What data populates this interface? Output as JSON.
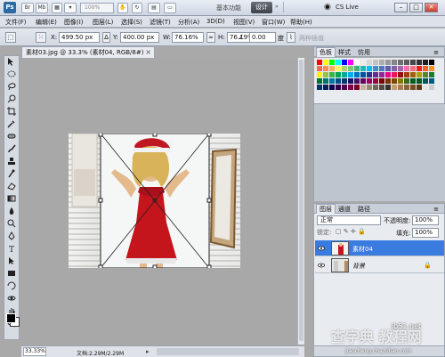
{
  "app": {
    "logo": "Ps",
    "zoom_display": "100%",
    "workspace_label": "基本功能",
    "workspace_active": "设计",
    "workspace_more": "»",
    "cs_live": "CS Live"
  },
  "menu": [
    "文件(F)",
    "编辑(E)",
    "图像(I)",
    "图层(L)",
    "选择(S)",
    "滤镜(T)",
    "分析(A)",
    "3D(D)",
    "视图(V)",
    "窗口(W)",
    "帮助(H)"
  ],
  "options": {
    "x_label": "X:",
    "x_value": "499.50 px",
    "y_label": "Y:",
    "y_value": "400.00 px",
    "w_label": "W:",
    "w_value": "76.16%",
    "h_label": "H:",
    "h_value": "76.19%",
    "angle_value": "0.00",
    "h_skew_label": "度",
    "interp_label": "两种插值"
  },
  "document": {
    "tab_title": "素材03.jpg @ 33.3% (素材04, RGB/8#)",
    "zoom": "33.33%",
    "doc_info": "文档:2.29M/2.29M"
  },
  "swatches_panel": {
    "tabs": [
      "色板",
      "样式",
      "仿用"
    ],
    "colors": [
      "#ff0000",
      "#ffff00",
      "#00ff00",
      "#00ffff",
      "#0000ff",
      "#ff00ff",
      "#ffffff",
      "#ebebeb",
      "#d6d6d6",
      "#c2c2c2",
      "#adadad",
      "#999999",
      "#858585",
      "#707070",
      "#5c5c5c",
      "#474747",
      "#333333",
      "#1f1f1f",
      "#000000",
      "#f26c4f",
      "#f68e55",
      "#fbaf5c",
      "#fff467",
      "#acd372",
      "#7cc576",
      "#3bb878",
      "#1abbb4",
      "#00bff3",
      "#438ccb",
      "#5574b9",
      "#605ca8",
      "#855fa8",
      "#a763a8",
      "#f06ea9",
      "#f26d7d",
      "#ed1c24",
      "#f26522",
      "#f7941d",
      "#fff200",
      "#8dc63f",
      "#39b54a",
      "#00a651",
      "#00a99d",
      "#00aeef",
      "#0072bc",
      "#0054a6",
      "#2e3192",
      "#662d91",
      "#92278f",
      "#ec008c",
      "#ed145b",
      "#9e0b0f",
      "#a0410d",
      "#a3620a",
      "#aba000",
      "#598527",
      "#1a7b30",
      "#007236",
      "#00746b",
      "#0076a3",
      "#004b80",
      "#003471",
      "#1b1464",
      "#440e62",
      "#630460",
      "#9e005d",
      "#9e0039",
      "#790000",
      "#7b2e00",
      "#7d4900",
      "#827b00",
      "#406618",
      "#005e20",
      "#005826",
      "#005952",
      "#005b7f",
      "#003663",
      "#002157",
      "#0d004c",
      "#32004b",
      "#4b0049",
      "#7b0046",
      "#7a0026",
      "#c7b299",
      "#998675",
      "#736357",
      "#534741",
      "#37302d",
      "#c69c6d",
      "#a67c52",
      "#8c6239",
      "#754c24",
      "#603913",
      "#e6e6e6",
      "#cccccc"
    ]
  },
  "layers_panel": {
    "tabs": [
      "图层",
      "通道",
      "路径"
    ],
    "blend_mode": "正常",
    "opacity_label": "不透明度:",
    "opacity": "100%",
    "lock_label": "锁定:",
    "fill_label": "填充:",
    "fill": "100%",
    "layers": [
      {
        "name": "素材04",
        "selected": true
      },
      {
        "name": "背景",
        "selected": false,
        "locked": true
      }
    ]
  },
  "watermark": {
    "url": "jb51.net",
    "text": "查字典 教程网",
    "site": "jiaocheng.chazidian.com"
  }
}
